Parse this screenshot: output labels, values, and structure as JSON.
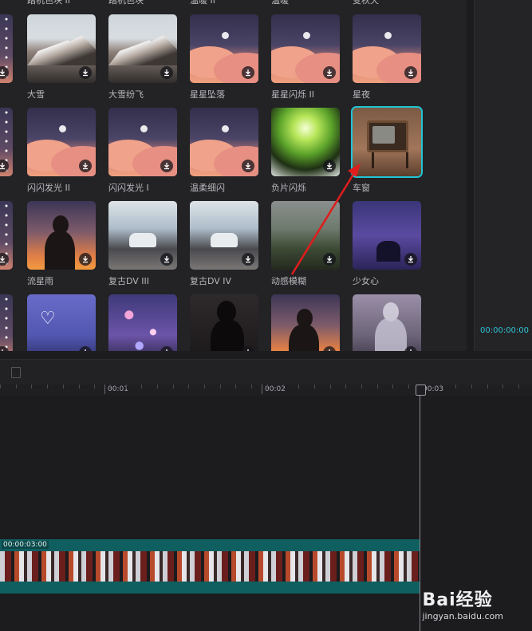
{
  "effects_panel": {
    "row_top_labels": [
      "踏机色块 II",
      "踏机色块",
      "温暖 II",
      "温暖",
      "变秋天"
    ],
    "rows": [
      [
        {
          "label": "大雪",
          "style": "mountain"
        },
        {
          "label": "大雪纷飞",
          "style": "mountain"
        },
        {
          "label": "星星坠落",
          "style": "cloud"
        },
        {
          "label": "星星闪烁 II",
          "style": "cloud"
        },
        {
          "label": "星夜",
          "style": "cloud"
        }
      ],
      [
        {
          "label": "闪闪发光 II",
          "style": "cloud"
        },
        {
          "label": "闪闪发光 I",
          "style": "cloud"
        },
        {
          "label": "温柔细闪",
          "style": "cloud"
        },
        {
          "label": "负片闪烁",
          "style": "green"
        },
        {
          "label": "车窗",
          "style": "tv",
          "selected": true
        }
      ],
      [
        {
          "label": "流星雨",
          "style": "silhouette"
        },
        {
          "label": "复古DV III",
          "style": "car"
        },
        {
          "label": "复古DV IV",
          "style": "car"
        },
        {
          "label": "动感模糊",
          "style": "blur"
        },
        {
          "label": "少女心",
          "style": "night"
        }
      ],
      [
        {
          "label": "",
          "style": "heart"
        },
        {
          "label": "",
          "style": "bokeh"
        },
        {
          "label": "",
          "style": "dark"
        },
        {
          "label": "",
          "style": "silhouette"
        },
        {
          "label": "",
          "style": "fog"
        }
      ]
    ]
  },
  "preview": {
    "timecode": "00:00:00:00"
  },
  "timeline": {
    "ruler_labels": [
      "00:01",
      "00:02",
      "00:03"
    ],
    "clip_duration": "00:00:03:00"
  },
  "watermark": {
    "logo": "Bai经验",
    "url": "jingyan.baidu.com"
  },
  "colors": {
    "accent": "#20c5d5",
    "clip": "#0f5f60",
    "annotation_arrow": "#e01c1c"
  }
}
